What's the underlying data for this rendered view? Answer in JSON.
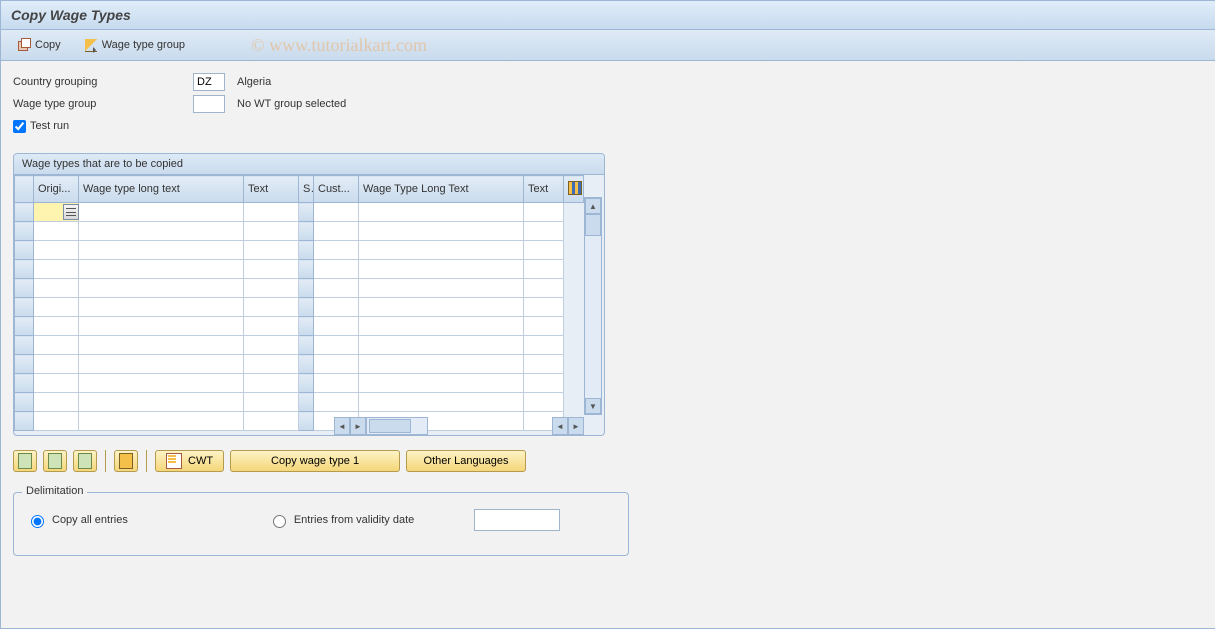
{
  "title": "Copy Wage Types",
  "toolbar": {
    "copy_label": "Copy",
    "wtgroup_label": "Wage type group"
  },
  "watermark": "© www.tutorialkart.com",
  "form": {
    "country_grouping_label": "Country grouping",
    "country_grouping_value": "DZ",
    "country_grouping_text": "Algeria",
    "wage_type_group_label": "Wage type group",
    "wage_type_group_value": "",
    "wage_type_group_text": "No WT group selected",
    "test_run_label": "Test run",
    "test_run_checked": true
  },
  "grid": {
    "title": "Wage types that are to be copied",
    "columns": {
      "c1": "Origi...",
      "c2": "Wage type long text",
      "c3": "Text",
      "c4": "S",
      "c5": "Cust...",
      "c6": "Wage Type Long Text",
      "c7": "Text"
    },
    "rows": 12
  },
  "actions": {
    "cwt_label": "CWT",
    "copy1_label": "Copy wage type 1",
    "otherlang_label": "Other Languages"
  },
  "delimitation": {
    "legend": "Delimitation",
    "copy_all_label": "Copy all entries",
    "from_date_label": "Entries from validity date",
    "selected": "copy_all",
    "date_value": ""
  }
}
